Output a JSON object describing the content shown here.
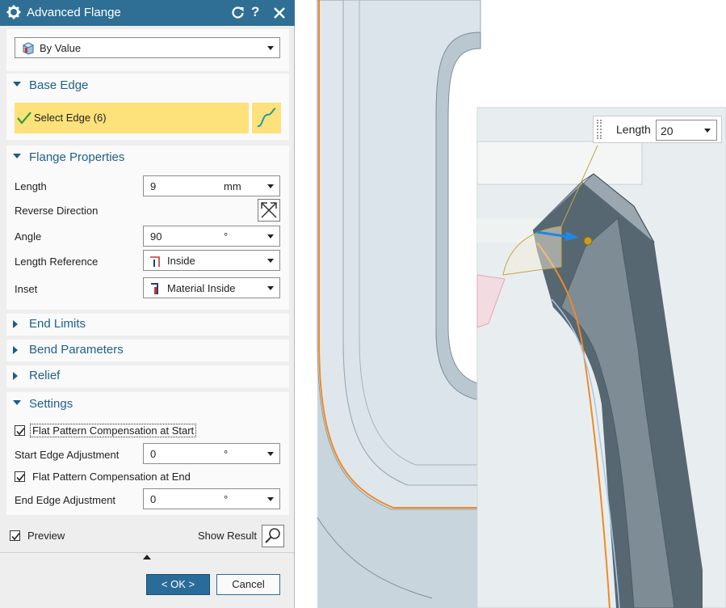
{
  "dialog": {
    "title": "Advanced Flange",
    "type_select": {
      "value": "By Value"
    },
    "base_edge": {
      "heading": "Base Edge",
      "select_label": "Select Edge (6)"
    },
    "flange_properties": {
      "heading": "Flange Properties",
      "length": {
        "label": "Length",
        "value": "9",
        "unit": "mm"
      },
      "reverse_direction": {
        "label": "Reverse Direction"
      },
      "angle": {
        "label": "Angle",
        "value": "90",
        "unit": "°"
      },
      "length_reference": {
        "label": "Length Reference",
        "value": "Inside"
      },
      "inset": {
        "label": "Inset",
        "value": "Material Inside"
      }
    },
    "end_limits": {
      "heading": "End Limits"
    },
    "bend_parameters": {
      "heading": "Bend Parameters"
    },
    "relief": {
      "heading": "Relief"
    },
    "settings": {
      "heading": "Settings",
      "flat_start": {
        "label": "Flat Pattern Compensation at Start",
        "checked": true
      },
      "start_edge_adj": {
        "label": "Start Edge Adjustment",
        "value": "0",
        "unit": "°"
      },
      "flat_end": {
        "label": "Flat Pattern Compensation at End",
        "checked": true
      },
      "end_edge_adj": {
        "label": "End Edge Adjustment",
        "value": "0",
        "unit": "°"
      }
    },
    "preview": {
      "label": "Preview",
      "checked": true
    },
    "show_result": {
      "label": "Show Result"
    },
    "ok_label": "< OK >",
    "cancel_label": "Cancel"
  },
  "viewport": {
    "length_handle": {
      "label": "Length",
      "value": "20"
    }
  },
  "colors": {
    "title_bar": "#2f6f95",
    "section_heading": "#1f5f8b",
    "selection_highlight": "#fde17a",
    "ok_button": "#2a6c99",
    "edge_highlight": "#f08a24",
    "drag_arrow": "#1e88e5"
  }
}
